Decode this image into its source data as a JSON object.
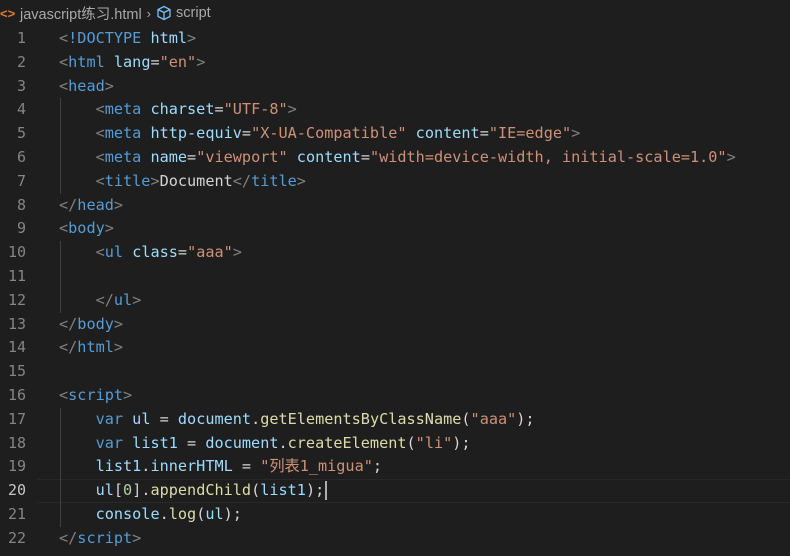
{
  "breadcrumb": {
    "file_icon": "<>",
    "file_name": "javascript练习.html",
    "separator": "›",
    "symbol_icon": "cube-symbol-icon",
    "symbol_name": "script"
  },
  "editor": {
    "current_line": 20,
    "colors": {
      "background": "#1e1e1e",
      "tag": "#569cd6",
      "attribute": "#9cdcfe",
      "string": "#ce9178",
      "function": "#dcdcaa",
      "number": "#b5cea8",
      "punctuation": "#808080",
      "text": "#d4d4d4"
    },
    "lines": [
      {
        "n": "1",
        "tokens": [
          [
            "punct",
            "<"
          ],
          [
            "tag",
            "!DOCTYPE"
          ],
          [
            "text",
            " "
          ],
          [
            "attr",
            "html"
          ],
          [
            "punct",
            ">"
          ]
        ]
      },
      {
        "n": "2",
        "tokens": [
          [
            "punct",
            "<"
          ],
          [
            "tag",
            "html"
          ],
          [
            "text",
            " "
          ],
          [
            "attr",
            "lang"
          ],
          [
            "text",
            "="
          ],
          [
            "str",
            "\"en\""
          ],
          [
            "punct",
            ">"
          ]
        ]
      },
      {
        "n": "3",
        "tokens": [
          [
            "punct",
            "<"
          ],
          [
            "tag",
            "head"
          ],
          [
            "punct",
            ">"
          ]
        ]
      },
      {
        "n": "4",
        "tokens": [
          [
            "text",
            "    "
          ],
          [
            "punct",
            "<"
          ],
          [
            "tag",
            "meta"
          ],
          [
            "text",
            " "
          ],
          [
            "attr",
            "charset"
          ],
          [
            "text",
            "="
          ],
          [
            "str",
            "\"UTF-8\""
          ],
          [
            "punct",
            ">"
          ]
        ]
      },
      {
        "n": "5",
        "tokens": [
          [
            "text",
            "    "
          ],
          [
            "punct",
            "<"
          ],
          [
            "tag",
            "meta"
          ],
          [
            "text",
            " "
          ],
          [
            "attr",
            "http-equiv"
          ],
          [
            "text",
            "="
          ],
          [
            "str",
            "\"X-UA-Compatible\""
          ],
          [
            "text",
            " "
          ],
          [
            "attr",
            "content"
          ],
          [
            "text",
            "="
          ],
          [
            "str",
            "\"IE=edge\""
          ],
          [
            "punct",
            ">"
          ]
        ]
      },
      {
        "n": "6",
        "tokens": [
          [
            "text",
            "    "
          ],
          [
            "punct",
            "<"
          ],
          [
            "tag",
            "meta"
          ],
          [
            "text",
            " "
          ],
          [
            "attr",
            "name"
          ],
          [
            "text",
            "="
          ],
          [
            "str",
            "\"viewport\""
          ],
          [
            "text",
            " "
          ],
          [
            "attr",
            "content"
          ],
          [
            "text",
            "="
          ],
          [
            "str",
            "\"width=device-width, initial-scale=1.0\""
          ],
          [
            "punct",
            ">"
          ]
        ]
      },
      {
        "n": "7",
        "tokens": [
          [
            "text",
            "    "
          ],
          [
            "punct",
            "<"
          ],
          [
            "tag",
            "title"
          ],
          [
            "punct",
            ">"
          ],
          [
            "text",
            "Document"
          ],
          [
            "punct",
            "</"
          ],
          [
            "tag",
            "title"
          ],
          [
            "punct",
            ">"
          ]
        ]
      },
      {
        "n": "8",
        "tokens": [
          [
            "punct",
            "</"
          ],
          [
            "tag",
            "head"
          ],
          [
            "punct",
            ">"
          ]
        ]
      },
      {
        "n": "9",
        "tokens": [
          [
            "punct",
            "<"
          ],
          [
            "tag",
            "body"
          ],
          [
            "punct",
            ">"
          ]
        ]
      },
      {
        "n": "10",
        "tokens": [
          [
            "text",
            "    "
          ],
          [
            "punct",
            "<"
          ],
          [
            "tag",
            "ul"
          ],
          [
            "text",
            " "
          ],
          [
            "attr",
            "class"
          ],
          [
            "text",
            "="
          ],
          [
            "str",
            "\"aaa\""
          ],
          [
            "punct",
            ">"
          ]
        ]
      },
      {
        "n": "11",
        "tokens": []
      },
      {
        "n": "12",
        "tokens": [
          [
            "text",
            "    "
          ],
          [
            "punct",
            "</"
          ],
          [
            "tag",
            "ul"
          ],
          [
            "punct",
            ">"
          ]
        ]
      },
      {
        "n": "13",
        "tokens": [
          [
            "punct",
            "</"
          ],
          [
            "tag",
            "body"
          ],
          [
            "punct",
            ">"
          ]
        ]
      },
      {
        "n": "14",
        "tokens": [
          [
            "punct",
            "</"
          ],
          [
            "tag",
            "html"
          ],
          [
            "punct",
            ">"
          ]
        ]
      },
      {
        "n": "15",
        "tokens": []
      },
      {
        "n": "16",
        "tokens": [
          [
            "punct",
            "<"
          ],
          [
            "tag",
            "script"
          ],
          [
            "punct",
            ">"
          ]
        ]
      },
      {
        "n": "17",
        "tokens": [
          [
            "text",
            "    "
          ],
          [
            "kw",
            "var"
          ],
          [
            "text",
            " "
          ],
          [
            "var",
            "ul"
          ],
          [
            "text",
            " = "
          ],
          [
            "var",
            "document"
          ],
          [
            "text",
            "."
          ],
          [
            "fn",
            "getElementsByClassName"
          ],
          [
            "text",
            "("
          ],
          [
            "str",
            "\"aaa\""
          ],
          [
            "text",
            ");"
          ]
        ]
      },
      {
        "n": "18",
        "tokens": [
          [
            "text",
            "    "
          ],
          [
            "kw",
            "var"
          ],
          [
            "text",
            " "
          ],
          [
            "var",
            "list1"
          ],
          [
            "text",
            " = "
          ],
          [
            "var",
            "document"
          ],
          [
            "text",
            "."
          ],
          [
            "fn",
            "createElement"
          ],
          [
            "text",
            "("
          ],
          [
            "str",
            "\"li\""
          ],
          [
            "text",
            ");"
          ]
        ]
      },
      {
        "n": "19",
        "tokens": [
          [
            "text",
            "    "
          ],
          [
            "var",
            "list1"
          ],
          [
            "text",
            "."
          ],
          [
            "var",
            "innerHTML"
          ],
          [
            "text",
            " = "
          ],
          [
            "str",
            "\"列表1_migua\""
          ],
          [
            "text",
            ";"
          ]
        ]
      },
      {
        "n": "20",
        "tokens": [
          [
            "text",
            "    "
          ],
          [
            "var",
            "ul"
          ],
          [
            "text",
            "["
          ],
          [
            "num",
            "0"
          ],
          [
            "text",
            "]."
          ],
          [
            "fn",
            "appendChild"
          ],
          [
            "text",
            "("
          ],
          [
            "var",
            "list1"
          ],
          [
            "text",
            ");"
          ]
        ]
      },
      {
        "n": "21",
        "tokens": [
          [
            "text",
            "    "
          ],
          [
            "var",
            "console"
          ],
          [
            "text",
            "."
          ],
          [
            "fn",
            "log"
          ],
          [
            "text",
            "("
          ],
          [
            "var",
            "ul"
          ],
          [
            "text",
            ");"
          ]
        ]
      },
      {
        "n": "22",
        "tokens": [
          [
            "punct",
            "</"
          ],
          [
            "tag",
            "script"
          ],
          [
            "punct",
            ">"
          ]
        ]
      }
    ]
  }
}
